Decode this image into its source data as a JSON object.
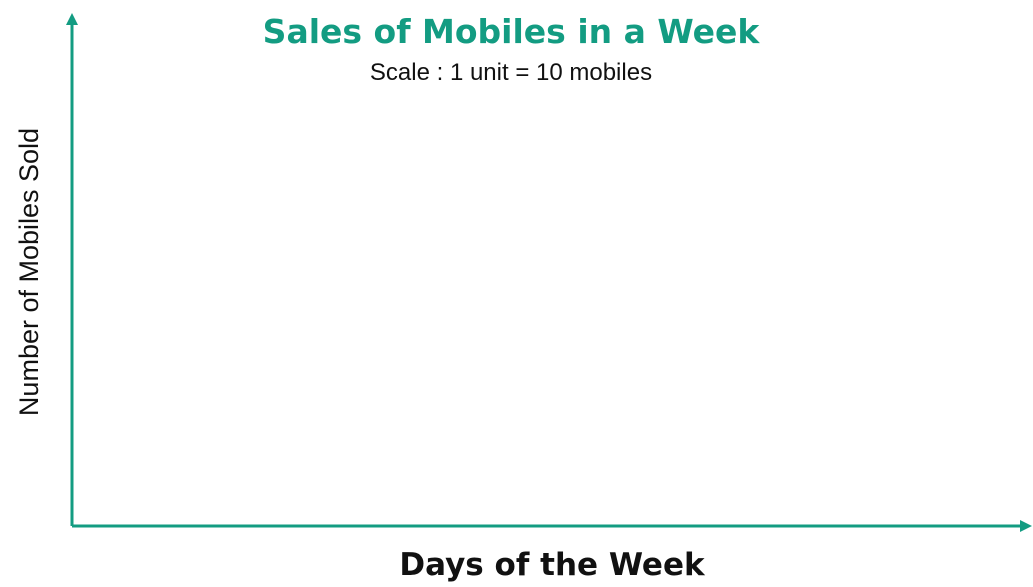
{
  "chart_data": {
    "type": "bar",
    "title": "Sales of Mobiles in a Week",
    "subtitle": "Scale : 1 unit = 10 mobiles",
    "xlabel": "Days of the Week",
    "ylabel": "Number of Mobiles Sold",
    "categories": [],
    "values": [],
    "grid": false
  },
  "colors": {
    "title": "#139C82",
    "axis": "#139C82",
    "text": "#111111"
  }
}
